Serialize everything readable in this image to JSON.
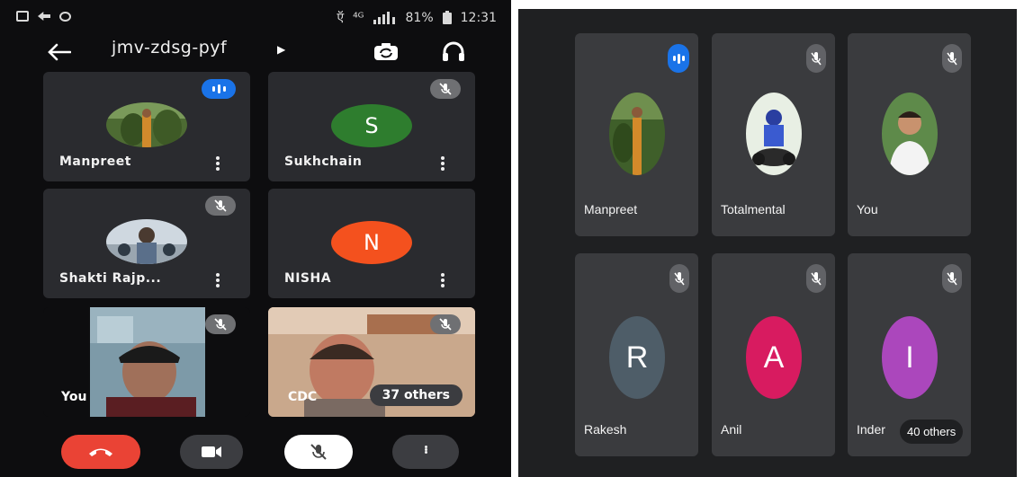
{
  "phone": {
    "status": {
      "carrier": "ऍ",
      "network": "⁴ᴳ",
      "battery": "81%",
      "time": "12:31"
    },
    "meeting_code": "jmv-zdsg-pyf",
    "tiles": [
      {
        "name": "Manpreet",
        "state": "speaking"
      },
      {
        "name": "Sukhchain",
        "initial": "S",
        "color": "#2e7d2e",
        "state": "muted"
      },
      {
        "name": "Shakti Rajp...",
        "state": "muted"
      },
      {
        "name": "NISHA",
        "initial": "N",
        "color": "#f4511e",
        "state": "unmuted"
      },
      {
        "name": "You",
        "state": "muted"
      },
      {
        "name": "CDC",
        "state": "muted",
        "others": "37 others"
      }
    ],
    "controls": [
      "end-call",
      "camera",
      "microphone-muted",
      "more-options"
    ]
  },
  "desktop": {
    "tiles": [
      {
        "name": "Manpreet",
        "state": "speaking"
      },
      {
        "name": "Totalmental",
        "state": "muted"
      },
      {
        "name": "You",
        "state": "muted"
      },
      {
        "name": "Rakesh",
        "initial": "R",
        "color": "#4e5d68",
        "state": "muted"
      },
      {
        "name": "Anil",
        "initial": "A",
        "color": "#d81b60",
        "state": "muted"
      },
      {
        "name": "Inder",
        "initial": "I",
        "color": "#ab47bc",
        "state": "muted",
        "others": "40 others"
      }
    ]
  }
}
